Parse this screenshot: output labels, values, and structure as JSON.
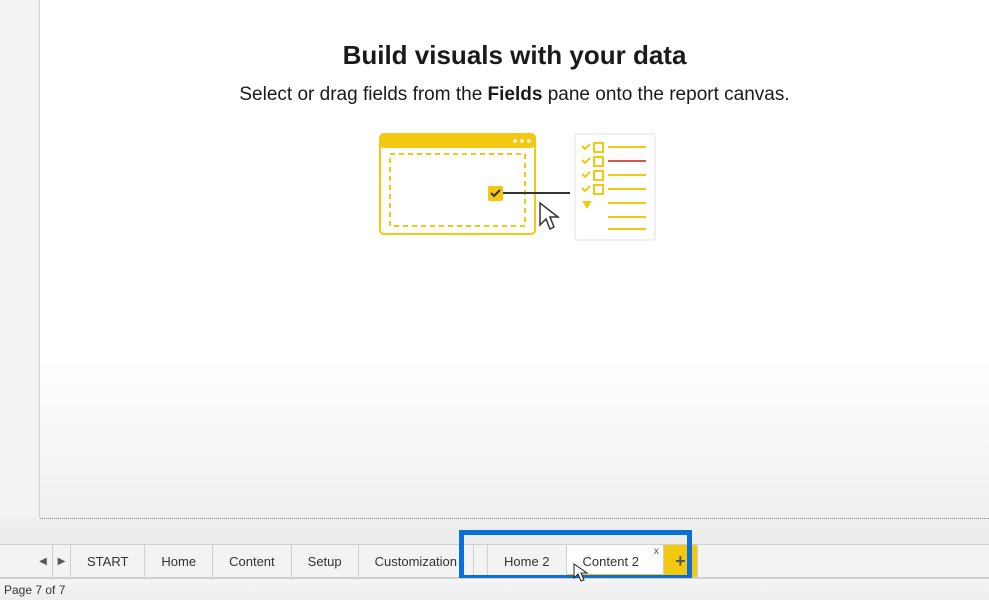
{
  "empty_state": {
    "title": "Build visuals with your data",
    "subtext_before": "Select or drag fields from the ",
    "subtext_bold": "Fields",
    "subtext_after": " pane onto the report canvas."
  },
  "tabs": {
    "items": [
      {
        "label": "START"
      },
      {
        "label": "Home"
      },
      {
        "label": "Content"
      },
      {
        "label": "Setup"
      },
      {
        "label": "Customization"
      },
      {
        "label": "Home 2"
      },
      {
        "label": "Content 2"
      }
    ],
    "add_label": "+"
  },
  "nav": {
    "prev": "◀",
    "next": "▶"
  },
  "status": {
    "text": "Page 7 of 7"
  },
  "close_glyph": "x"
}
